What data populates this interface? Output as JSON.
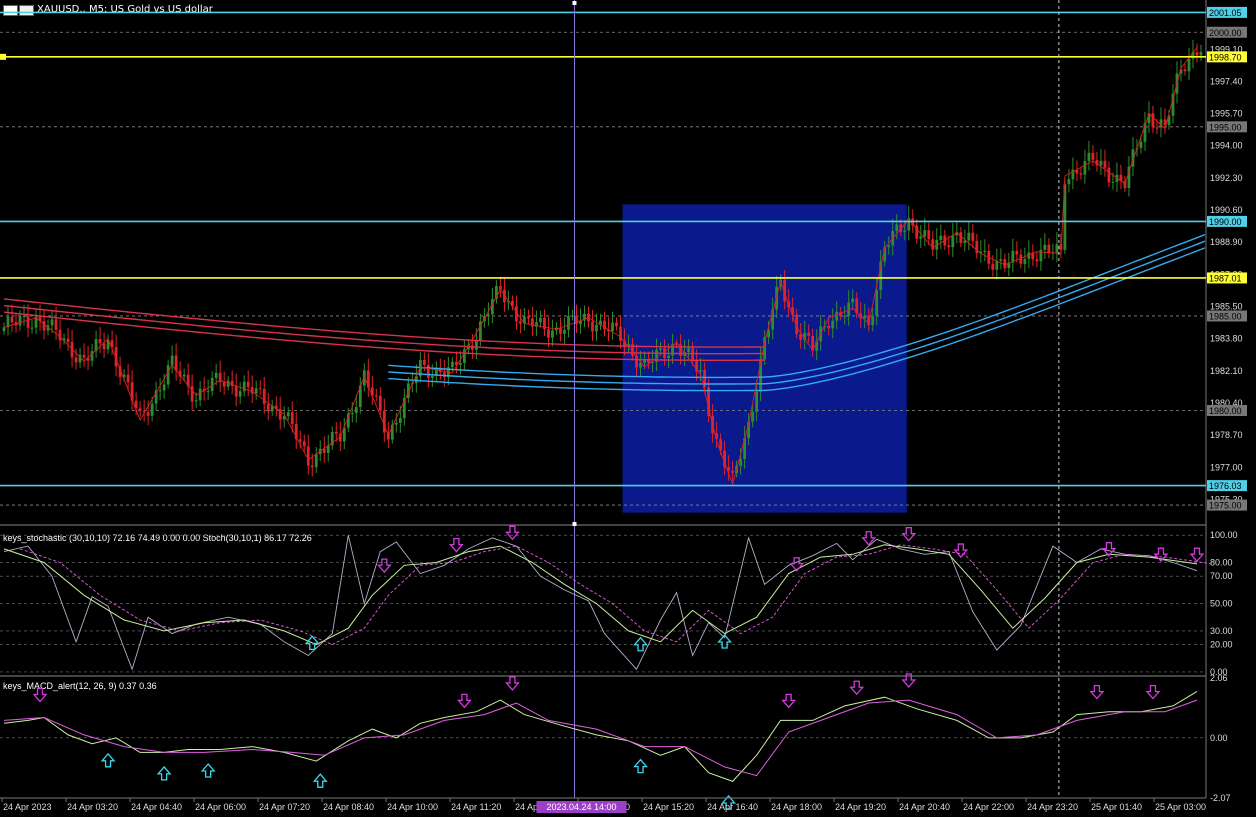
{
  "header": {
    "symbol": "XAUUSD.,",
    "timeframe": "M5:",
    "description": "US Gold vs US dollar"
  },
  "indicators": {
    "stoch_label": "keys_stochastic (30,10,10) 72.16 74.49 0.00 0.00 Stoch(30,10,1) 86.17 72.26",
    "macd_label": "keys_MACD_alert(12, 26, 9) 0.37 0.36"
  },
  "crosshair_time_label": "2023.04.24 14:00",
  "colors": {
    "background": "#000000",
    "bull": "#2e8b2e",
    "bear": "#e0222a",
    "zone": "#0a1a8c",
    "level_cyan": "#4fd0e8",
    "level_yellow": "#ffff33",
    "ema_red": "#d8334a",
    "ema_blue": "#35aaf0",
    "arrow_buy": "#3ad8f0",
    "arrow_sell": "#d23adf"
  },
  "icons": {
    "buy": "up-arrow-icon",
    "sell": "down-arrow-icon"
  },
  "chart_data": [
    {
      "type": "candlestick",
      "title": "XAUUSD., M5: US Gold vs US dollar",
      "ylim": [
        1974.0,
        2001.6
      ],
      "y_ticks": [
        "2000.00",
        "1999.10",
        "1997.40",
        "1995.70",
        "1994.00",
        "1992.30",
        "1990.60",
        "1988.90",
        "1987.20",
        "1985.50",
        "1983.80",
        "1982.10",
        "1980.40",
        "1978.70",
        "1977.00",
        "1975.30"
      ],
      "x_ticks": [
        "24 Apr 2023",
        "24 Apr 03:20",
        "24 Apr 04:40",
        "24 Apr 06:00",
        "24 Apr 07:20",
        "24 Apr 08:40",
        "24 Apr 10:00",
        "24 Apr 11:20",
        "24 Apr 12:40",
        "24 Apr 14:00",
        "24 Apr 15:20",
        "24 Apr 16:40",
        "24 Apr 18:00",
        "24 Apr 19:20",
        "24 Apr 20:40",
        "24 Apr 22:00",
        "24 Apr 23:20",
        "25 Apr 01:40",
        "25 Apr 03:00"
      ],
      "close_anchors": [
        [
          0,
          1984.4
        ],
        [
          8,
          1984.9
        ],
        [
          14,
          1983.9
        ],
        [
          20,
          1982.6
        ],
        [
          26,
          1983.8
        ],
        [
          34,
          1979.5
        ],
        [
          42,
          1982.4
        ],
        [
          48,
          1980.8
        ],
        [
          54,
          1981.6
        ],
        [
          62,
          1981.0
        ],
        [
          70,
          1979.8
        ],
        [
          76,
          1977.4
        ],
        [
          84,
          1978.6
        ],
        [
          90,
          1981.8
        ],
        [
          96,
          1978.7
        ],
        [
          104,
          1982.3
        ],
        [
          112,
          1982.0
        ],
        [
          118,
          1984.1
        ],
        [
          124,
          1986.4
        ],
        [
          130,
          1984.6
        ],
        [
          138,
          1984.3
        ],
        [
          146,
          1984.9
        ],
        [
          154,
          1983.9
        ],
        [
          160,
          1982.3
        ],
        [
          168,
          1983.6
        ],
        [
          174,
          1981.9
        ],
        [
          178,
          1978.4
        ],
        [
          182,
          1976.1
        ],
        [
          186,
          1979.3
        ],
        [
          190,
          1983.6
        ],
        [
          194,
          1986.8
        ],
        [
          198,
          1984.4
        ],
        [
          202,
          1983.2
        ],
        [
          206,
          1984.9
        ],
        [
          212,
          1985.4
        ],
        [
          216,
          1984.6
        ],
        [
          220,
          1988.6
        ],
        [
          226,
          1990.1
        ],
        [
          232,
          1988.6
        ],
        [
          238,
          1989.4
        ],
        [
          244,
          1988.3
        ],
        [
          250,
          1987.7
        ],
        [
          258,
          1988.4
        ],
        [
          264,
          1988.3
        ],
        [
          265,
          1992.4
        ],
        [
          272,
          1993.2
        ],
        [
          280,
          1992.0
        ],
        [
          286,
          1995.7
        ],
        [
          290,
          1994.9
        ],
        [
          294,
          1998.1
        ],
        [
          298,
          1999.2
        ]
      ],
      "resistance_levels": [
        "2001.05",
        "1990.00",
        "1976.03"
      ],
      "signal_levels": [
        "1998.70",
        "1987.01"
      ],
      "dashed_levels": [
        "2000.00",
        "1995.00",
        "1985.00",
        "1980.00",
        "1975.00"
      ],
      "level_labels": [
        "2001.05",
        "2000.00",
        "1998.70",
        "1995.00",
        "1990.00",
        "1987.01",
        "1985.00",
        "1980.00",
        "1976.03",
        "1975.00"
      ],
      "ema_red_start": 1985.2,
      "ema_red_end": 1983.0,
      "ema_blue_end": 1989.2,
      "highlight_zone": {
        "from_bar": 155,
        "to_bar": 226,
        "y_from": 1974.6,
        "y_to": 1990.9
      }
    },
    {
      "type": "line",
      "title": "keys_stochastic (30,10,10) 72.16 74.49 0.00 0.00 Stoch(30,10,1) 86.17 72.26",
      "ylim": [
        -3,
        106
      ],
      "y_ticks": [
        "100.00",
        "80.00",
        "70.00",
        "50.00",
        "30.00",
        "20.00",
        "0.00"
      ],
      "series_key": [
        "x",
        "value"
      ],
      "raw_stoch": [
        [
          0,
          88
        ],
        [
          6,
          92
        ],
        [
          12,
          70
        ],
        [
          18,
          22
        ],
        [
          22,
          55
        ],
        [
          26,
          48
        ],
        [
          32,
          2
        ],
        [
          36,
          40
        ],
        [
          42,
          28
        ],
        [
          48,
          35
        ],
        [
          56,
          40
        ],
        [
          64,
          35
        ],
        [
          70,
          22
        ],
        [
          76,
          12
        ],
        [
          82,
          28
        ],
        [
          86,
          100
        ],
        [
          90,
          50
        ],
        [
          94,
          88
        ],
        [
          98,
          95
        ],
        [
          104,
          72
        ],
        [
          110,
          78
        ],
        [
          116,
          90
        ],
        [
          122,
          98
        ],
        [
          128,
          92
        ],
        [
          134,
          70
        ],
        [
          140,
          60
        ],
        [
          146,
          52
        ],
        [
          150,
          28
        ],
        [
          154,
          15
        ],
        [
          158,
          2
        ],
        [
          164,
          38
        ],
        [
          168,
          58
        ],
        [
          172,
          12
        ],
        [
          176,
          36
        ],
        [
          180,
          25
        ],
        [
          186,
          98
        ],
        [
          190,
          64
        ],
        [
          196,
          78
        ],
        [
          202,
          85
        ],
        [
          208,
          94
        ],
        [
          212,
          82
        ],
        [
          218,
          97
        ],
        [
          224,
          90
        ],
        [
          230,
          86
        ],
        [
          236,
          88
        ],
        [
          242,
          44
        ],
        [
          248,
          16
        ],
        [
          254,
          34
        ],
        [
          262,
          92
        ],
        [
          268,
          80
        ],
        [
          274,
          90
        ],
        [
          280,
          86
        ],
        [
          286,
          85
        ],
        [
          292,
          80
        ],
        [
          298,
          74
        ]
      ],
      "signal": [
        [
          0,
          90
        ],
        [
          10,
          80
        ],
        [
          20,
          56
        ],
        [
          30,
          38
        ],
        [
          40,
          30
        ],
        [
          50,
          36
        ],
        [
          60,
          38
        ],
        [
          70,
          30
        ],
        [
          78,
          20
        ],
        [
          86,
          32
        ],
        [
          92,
          56
        ],
        [
          100,
          78
        ],
        [
          108,
          80
        ],
        [
          116,
          88
        ],
        [
          124,
          92
        ],
        [
          132,
          80
        ],
        [
          140,
          64
        ],
        [
          148,
          50
        ],
        [
          156,
          30
        ],
        [
          164,
          22
        ],
        [
          172,
          45
        ],
        [
          180,
          28
        ],
        [
          188,
          40
        ],
        [
          196,
          72
        ],
        [
          204,
          84
        ],
        [
          212,
          86
        ],
        [
          220,
          93
        ],
        [
          228,
          90
        ],
        [
          236,
          86
        ],
        [
          244,
          60
        ],
        [
          252,
          32
        ],
        [
          260,
          54
        ],
        [
          268,
          80
        ],
        [
          276,
          86
        ],
        [
          286,
          84
        ],
        [
          298,
          79
        ]
      ],
      "buy_arrows": [
        [
          77,
          26
        ],
        [
          159,
          25
        ],
        [
          180,
          27
        ]
      ],
      "sell_arrows": [
        [
          95,
          73
        ],
        [
          113,
          88
        ],
        [
          127,
          97
        ],
        [
          198,
          74
        ],
        [
          216,
          93
        ],
        [
          226,
          96
        ],
        [
          239,
          84
        ],
        [
          276,
          85
        ],
        [
          289,
          81
        ],
        [
          298,
          81
        ]
      ]
    },
    {
      "type": "line",
      "title": "keys_MACD_alert(12, 26, 9) 0.37 0.36",
      "ylim": [
        -2.07,
        2.06
      ],
      "y_ticks": [
        "2.06",
        "0.00",
        "-2.07"
      ],
      "macd": [
        [
          0,
          0.5
        ],
        [
          6,
          0.6
        ],
        [
          10,
          0.7
        ],
        [
          16,
          0.1
        ],
        [
          22,
          -0.2
        ],
        [
          28,
          0.0
        ],
        [
          34,
          -0.5
        ],
        [
          40,
          -0.5
        ],
        [
          46,
          -0.4
        ],
        [
          54,
          -0.4
        ],
        [
          62,
          -0.3
        ],
        [
          70,
          -0.5
        ],
        [
          78,
          -0.8
        ],
        [
          86,
          -0.1
        ],
        [
          92,
          0.3
        ],
        [
          98,
          0.0
        ],
        [
          104,
          0.5
        ],
        [
          110,
          0.7
        ],
        [
          118,
          0.9
        ],
        [
          124,
          1.3
        ],
        [
          130,
          0.8
        ],
        [
          140,
          0.4
        ],
        [
          148,
          0.1
        ],
        [
          156,
          -0.1
        ],
        [
          164,
          -0.6
        ],
        [
          170,
          -0.3
        ],
        [
          176,
          -1.2
        ],
        [
          182,
          -1.5
        ],
        [
          188,
          -0.6
        ],
        [
          194,
          0.6
        ],
        [
          202,
          0.6
        ],
        [
          210,
          1.1
        ],
        [
          220,
          1.4
        ],
        [
          228,
          1.0
        ],
        [
          238,
          0.6
        ],
        [
          246,
          0.0
        ],
        [
          254,
          0.0
        ],
        [
          262,
          0.2
        ],
        [
          268,
          0.8
        ],
        [
          276,
          0.9
        ],
        [
          284,
          0.9
        ],
        [
          292,
          1.1
        ],
        [
          298,
          1.6
        ]
      ],
      "signal": [
        [
          0,
          0.6
        ],
        [
          10,
          0.7
        ],
        [
          20,
          0.1
        ],
        [
          30,
          -0.3
        ],
        [
          40,
          -0.5
        ],
        [
          50,
          -0.5
        ],
        [
          62,
          -0.4
        ],
        [
          72,
          -0.5
        ],
        [
          80,
          -0.6
        ],
        [
          90,
          0.0
        ],
        [
          100,
          0.1
        ],
        [
          110,
          0.6
        ],
        [
          120,
          0.8
        ],
        [
          128,
          1.2
        ],
        [
          136,
          0.6
        ],
        [
          148,
          0.3
        ],
        [
          160,
          -0.3
        ],
        [
          170,
          -0.3
        ],
        [
          180,
          -1.0
        ],
        [
          188,
          -1.3
        ],
        [
          196,
          0.2
        ],
        [
          206,
          0.7
        ],
        [
          216,
          1.2
        ],
        [
          226,
          1.3
        ],
        [
          238,
          0.8
        ],
        [
          248,
          0.0
        ],
        [
          258,
          0.1
        ],
        [
          268,
          0.6
        ],
        [
          280,
          0.9
        ],
        [
          290,
          0.9
        ],
        [
          298,
          1.3
        ]
      ],
      "buy_arrows": [
        [
          26,
          -0.55
        ],
        [
          40,
          -1.0
        ],
        [
          51,
          -0.9
        ],
        [
          79,
          -1.25
        ],
        [
          159,
          -0.75
        ],
        [
          181,
          -2.0
        ]
      ],
      "sell_arrows": [
        [
          9,
          1.25
        ],
        [
          115,
          1.05
        ],
        [
          127,
          1.65
        ],
        [
          196,
          1.05
        ],
        [
          213,
          1.5
        ],
        [
          226,
          1.75
        ],
        [
          273,
          1.35
        ],
        [
          287,
          1.35
        ]
      ]
    }
  ]
}
